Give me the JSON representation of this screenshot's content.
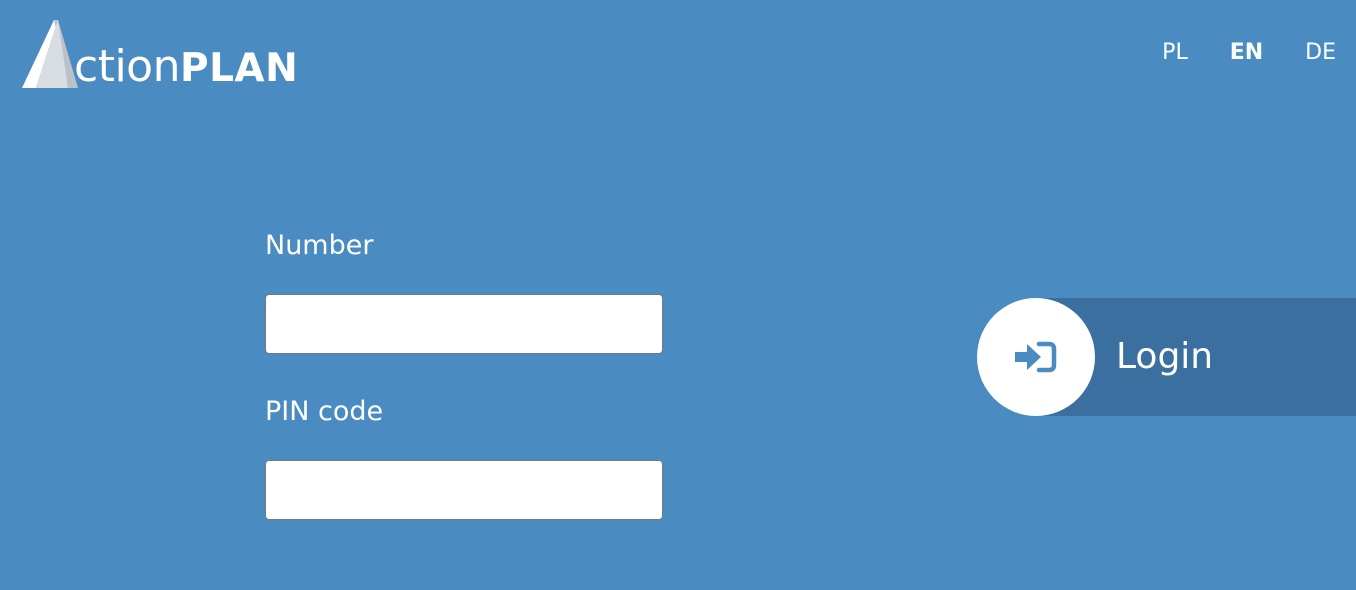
{
  "brand": {
    "name_light": "ction",
    "name_bold": "PLAN",
    "mark_icon": "actionplan-a-logo-icon"
  },
  "languages": [
    {
      "code": "PL",
      "active": false
    },
    {
      "code": "EN",
      "active": true
    },
    {
      "code": "DE",
      "active": false
    }
  ],
  "form": {
    "number_label": "Number",
    "number_value": "",
    "pin_label": "PIN code",
    "pin_value": ""
  },
  "login": {
    "label": "Login",
    "icon": "sign-in-icon"
  },
  "colors": {
    "background": "#4a8bc2",
    "login_bar": "#3a6f9f",
    "icon_blue": "#4a8bc2"
  }
}
